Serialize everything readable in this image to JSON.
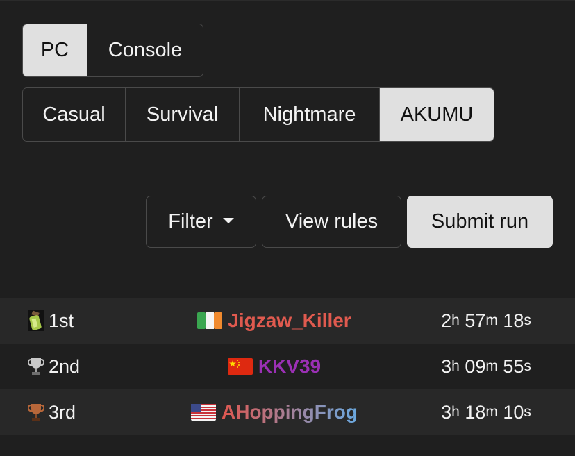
{
  "platform_tabs": [
    {
      "label": "PC",
      "active": true
    },
    {
      "label": "Console",
      "active": false
    }
  ],
  "difficulty_tabs": [
    {
      "label": "Casual",
      "active": false
    },
    {
      "label": "Survival",
      "active": false
    },
    {
      "label": "Nightmare",
      "active": false
    },
    {
      "label": "AKUMU",
      "active": true
    }
  ],
  "actions": {
    "filter_label": "Filter",
    "view_rules_label": "View rules",
    "submit_label": "Submit run"
  },
  "leaderboard": [
    {
      "rank": "1st",
      "rank_icon": "green-item-icon",
      "flag": "ireland-flag-icon",
      "player": "Jigzaw_Killer",
      "player_color": "#e05a4f",
      "time": {
        "h": "2",
        "m": "57",
        "s": "18"
      }
    },
    {
      "rank": "2nd",
      "rank_icon": "silver-trophy-icon",
      "flag": "china-flag-icon",
      "player": "KKV39",
      "player_color": "#9b30b5",
      "time": {
        "h": "3",
        "m": "09",
        "s": "55"
      }
    },
    {
      "rank": "3rd",
      "rank_icon": "bronze-trophy-icon",
      "flag": "usa-flag-icon",
      "player": "AHoppingFrog",
      "player_color": "#e0574f",
      "player_color_end": "#6aa9e0",
      "time": {
        "h": "3",
        "m": "18",
        "s": "10"
      }
    }
  ],
  "time_units": {
    "h": "h",
    "m": "m",
    "s": "s"
  }
}
